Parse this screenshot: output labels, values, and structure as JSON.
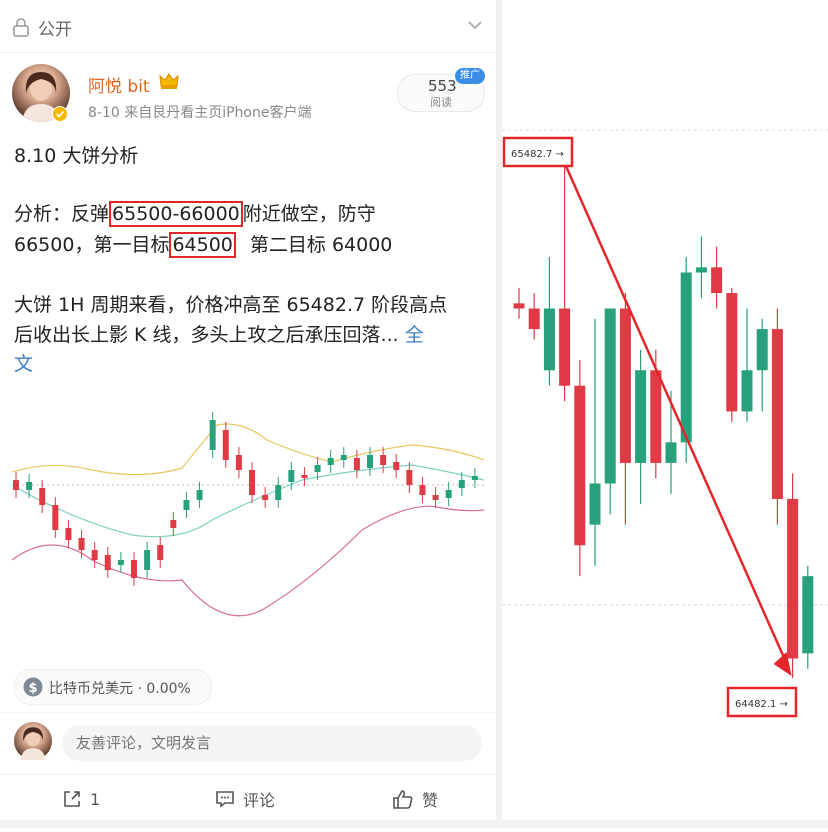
{
  "header": {
    "visibility_label": "公开",
    "lock_icon": "lock-icon",
    "menu_icon": "chevron-down-icon"
  },
  "author": {
    "name": "阿悦 bit",
    "meta": "8-10  来自艮丹看主页iPhone客户端",
    "badge_icon": "crown-icon",
    "verified_icon": "verified-icon"
  },
  "stats": {
    "reads_count": "553",
    "reads_label": "阅读",
    "promo_badge": "推广"
  },
  "post": {
    "title": "8.10 大饼分析",
    "analysis_prefix": "分析：反弹",
    "entry_range": "65500-66000",
    "analysis_mid": "附近做空，防守",
    "stop_and_target_label": "66500，第一目标",
    "target1": "64500",
    "target2_text": "第二目标 64000",
    "para2_line1": "大饼 1H 周期来看，价格冲高至 65482.7 阶段高点",
    "para2_line2": "后收出长上影 K 线，多头上攻之后承压回落...",
    "read_more_1": "全",
    "read_more_2": "文"
  },
  "topic": {
    "icon": "dollar-icon",
    "label": "比特币兑美元 · 0.00%"
  },
  "comment": {
    "placeholder": "友善评论，文明发言"
  },
  "actions": {
    "share": {
      "icon": "share-icon",
      "label": "1"
    },
    "comment": {
      "icon": "comment-icon",
      "label": "评论"
    },
    "like": {
      "icon": "thumbs-up-icon",
      "label": "赞"
    }
  },
  "colors": {
    "up": "#26a17b",
    "down": "#e03a45",
    "annotation": "#e2262a",
    "username": "#e0641f",
    "link": "#3e7fc9"
  },
  "chart_data": [
    {
      "type": "candlestick",
      "title": "",
      "indicator": "Bollinger Bands",
      "candles": "thumbnail of BTC 1H price action with Bollinger Bands"
    },
    {
      "type": "candlestick",
      "high_label": "65482.7",
      "low_label": "64482.1",
      "candles": [
        {
          "o": 65210,
          "h": 65240,
          "l": 65180,
          "c": 65200
        },
        {
          "o": 65200,
          "h": 65230,
          "l": 65140,
          "c": 65160
        },
        {
          "o": 65080,
          "h": 65300,
          "l": 65050,
          "c": 65200
        },
        {
          "o": 65200,
          "h": 65482.7,
          "l": 65020,
          "c": 65050
        },
        {
          "o": 65050,
          "h": 65100,
          "l": 64680,
          "c": 64740
        },
        {
          "o": 64780,
          "h": 65180,
          "l": 64700,
          "c": 64860
        },
        {
          "o": 64860,
          "h": 65200,
          "l": 64800,
          "c": 65200
        },
        {
          "o": 65200,
          "h": 65230,
          "l": 64780,
          "c": 64900
        },
        {
          "o": 64900,
          "h": 65120,
          "l": 64820,
          "c": 65080
        },
        {
          "o": 65080,
          "h": 65120,
          "l": 64870,
          "c": 64900
        },
        {
          "o": 64900,
          "h": 65040,
          "l": 64840,
          "c": 64940
        },
        {
          "o": 64940,
          "h": 65300,
          "l": 64900,
          "c": 65270
        },
        {
          "o": 65270,
          "h": 65340,
          "l": 65220,
          "c": 65280
        },
        {
          "o": 65280,
          "h": 65320,
          "l": 65200,
          "c": 65230
        },
        {
          "o": 65230,
          "h": 65240,
          "l": 64980,
          "c": 65000
        },
        {
          "o": 65000,
          "h": 65200,
          "l": 64980,
          "c": 65080
        },
        {
          "o": 65080,
          "h": 65180,
          "l": 65000,
          "c": 65160
        },
        {
          "o": 65160,
          "h": 65200,
          "l": 64780,
          "c": 64830
        },
        {
          "o": 64830,
          "h": 64880,
          "l": 64482.1,
          "c": 64520
        },
        {
          "o": 64530,
          "h": 64700,
          "l": 64500,
          "c": 64680
        }
      ],
      "annotations": [
        "65482.7",
        "64482.1"
      ],
      "dashed_lines": [
        65482.7,
        64482.1
      ]
    }
  ]
}
